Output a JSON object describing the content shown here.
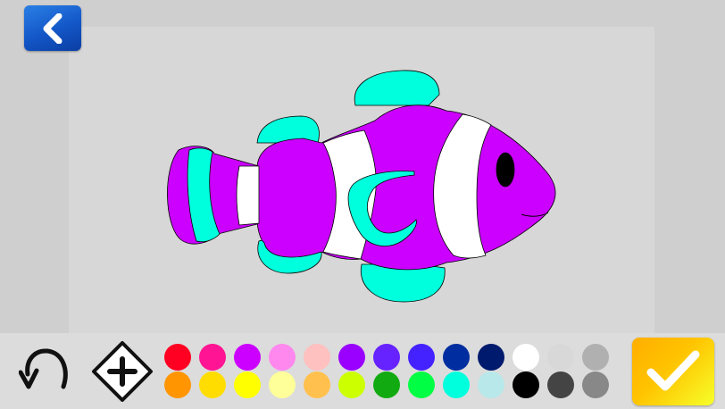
{
  "buttons": {
    "back_icon": "chevron-left-icon",
    "undo_icon": "undo-arrow-icon",
    "eraser_icon": "add-eraser-icon",
    "confirm_icon": "checkmark-icon"
  },
  "picture": {
    "subject": "clownfish",
    "regions": {
      "body": "#cc00ff",
      "stripes": "#ffffff",
      "fins": "#00ffdd",
      "eye": "#000000",
      "outline": "#000000"
    }
  },
  "palette": {
    "selected_color": "#00ffdd",
    "colors": [
      "#ff0022",
      "#ff1493",
      "#cc00ff",
      "#ff88ee",
      "#ffc0c0",
      "#9900ff",
      "#6622ff",
      "#4422ff",
      "#002ea0",
      "#001a6e",
      "#ffffff",
      "#d8d8d8",
      "#b0b0b0",
      "#ff9500",
      "#ffdd00",
      "#ffff00",
      "#ffff99",
      "#ffc04d",
      "#ccff00",
      "#11aa11",
      "#00ff44",
      "#00ffdd",
      "#b8e8ea",
      "#000000",
      "#444444",
      "#888888"
    ]
  }
}
